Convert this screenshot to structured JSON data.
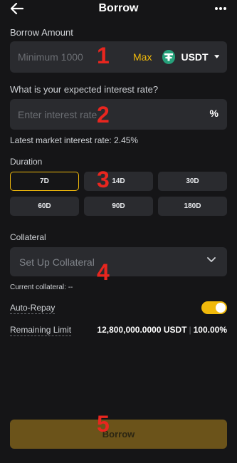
{
  "header": {
    "title": "Borrow",
    "back_icon": "arrow-left-icon",
    "more_icon": "more-dots-icon"
  },
  "borrow_amount": {
    "label": "Borrow Amount",
    "placeholder": "Minimum 1000",
    "max_label": "Max",
    "coin": "USDT",
    "coin_icon": "tether-icon"
  },
  "interest": {
    "question": "What is your expected interest rate?",
    "placeholder": "Enter interest rate",
    "unit": "%",
    "market_rate_text": "Latest market interest rate: 2.45%"
  },
  "duration": {
    "label": "Duration",
    "selected": "7D",
    "options": [
      "7D",
      "14D",
      "30D",
      "60D",
      "90D",
      "180D"
    ]
  },
  "collateral": {
    "label": "Collateral",
    "placeholder": "Set Up Collateral",
    "current_text": "Current collateral: --"
  },
  "auto_repay": {
    "label": "Auto-Repay",
    "enabled": true
  },
  "remaining_limit": {
    "label": "Remaining Limit",
    "amount": "12,800,000.0000 USDT",
    "separator": "|",
    "percent": "100.00%"
  },
  "footer": {
    "borrow_label": "Borrow"
  },
  "annotations": [
    "1",
    "2",
    "3",
    "4",
    "5"
  ],
  "colors": {
    "background": "#151517",
    "field": "#2a2b2f",
    "accent": "#f0b90b",
    "annotation": "#e8261f"
  }
}
